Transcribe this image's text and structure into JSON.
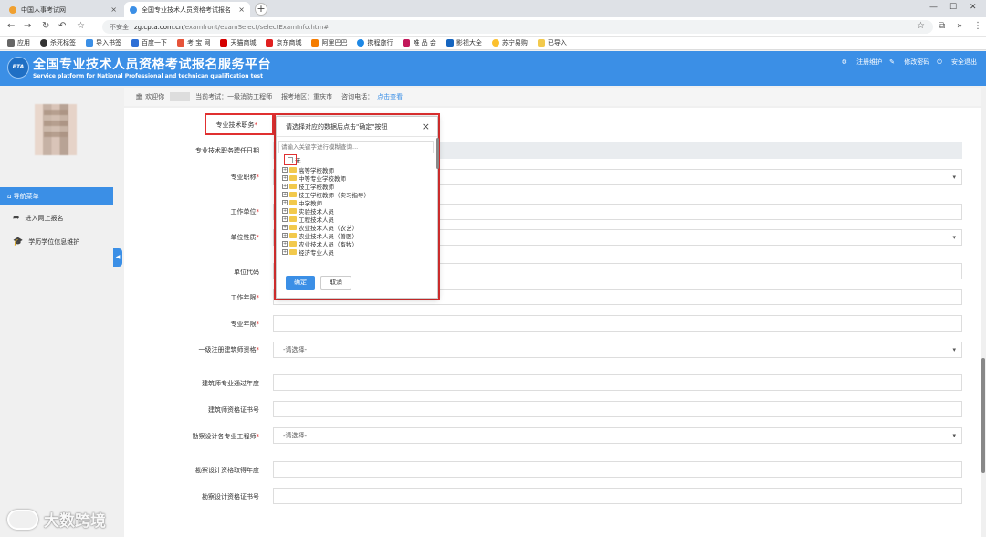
{
  "browser": {
    "tabs": [
      {
        "title": "中国人事考试网",
        "close": "×"
      },
      {
        "title": "全国专业技术人员资格考试报名",
        "close": "×"
      }
    ],
    "new_tab": "+",
    "url_security": "不安全",
    "url_host": "zg.cpta.com.cn",
    "url_path": "/examfront/examSelect/selectExamInfo.htm#",
    "bookmarks": [
      "应用",
      "杀死标签",
      "导入书签",
      "百度一下",
      "考 宝 网",
      "天猫商城",
      "京东商城",
      "阿里巴巴",
      "携程旅行",
      "唯 品 会",
      "影视大全",
      "苏宁易购",
      "已导入"
    ]
  },
  "header": {
    "logo_text": "PTA",
    "title": "全国专业技术人员资格考试报名服务平台",
    "subtitle": "Service platform for National Professional and technican qualification test",
    "links": [
      "注册维护",
      "修改密码",
      "安全退出"
    ]
  },
  "infobar": {
    "welcome": "欢迎你",
    "exam": "当前考试：一级消防工程师",
    "region": "报考地区：重庆市",
    "phone_label": "咨询电话：",
    "phone_link": "点击查看"
  },
  "sidebar": {
    "nav_title": "导航菜单",
    "items": [
      "进入网上报名",
      "学历学位信息维护"
    ]
  },
  "form": {
    "labels": {
      "title": "专业技术职务",
      "title_date": "专业技术职务聘任日期",
      "prof_title": "专业职称",
      "work_unit": "工作单位",
      "unit_type": "单位性质",
      "unit_code": "单位代码",
      "work_years": "工作年限",
      "prof_years": "专业年限",
      "architect": "一级注册建筑师资格",
      "arch_year": "建筑师专业通过年度",
      "arch_cert": "建筑师资格证书号",
      "survey": "勘察设计各专业工程师",
      "survey_year": "勘察设计资格取得年度",
      "survey_cert": "勘察设计资格证书号"
    },
    "required_mark": "*",
    "select_placeholder": "-请选择-"
  },
  "dialog": {
    "title": "请选择对应的数据后点击\"确定\"按钮",
    "close": "×",
    "search_placeholder": "请输入关键字进行模糊查询...",
    "none_option": "无",
    "tree_items": [
      "高等学校教师",
      "中等专业学校教师",
      "技工学校教师",
      "技工学校教师（实习指导）",
      "中学教师",
      "实验技术人员",
      "工程技术人员",
      "农业技术人员（农艺）",
      "农业技术人员（兽医）",
      "农业技术人员（畜牧）",
      "经济专业人员"
    ],
    "expand": "+",
    "ok": "确定",
    "cancel": "取消"
  },
  "watermark": "大数跨境",
  "colors": {
    "brand": "#3b8fe6",
    "highlight": "#e03030"
  }
}
